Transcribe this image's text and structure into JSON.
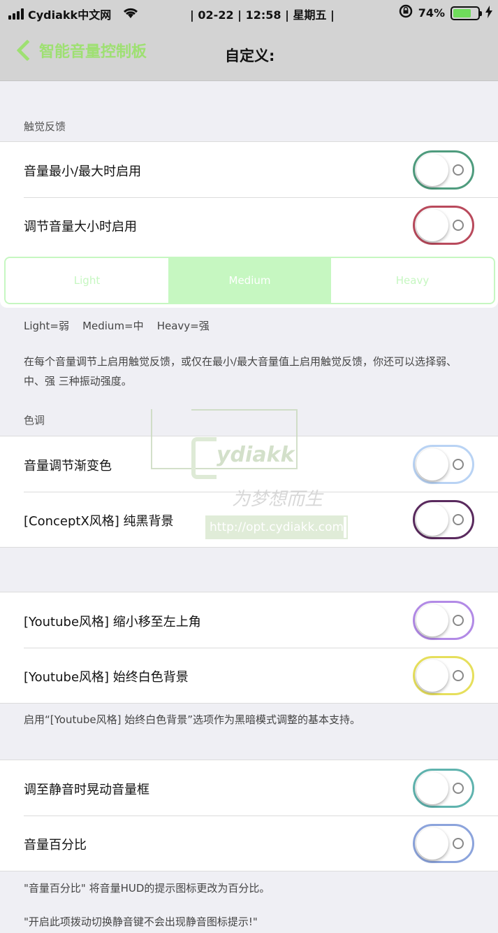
{
  "status_bar": {
    "carrier": "Cydiakk中文网",
    "center": "| 02-22 | 12:58 | 星期五 |",
    "battery_percent": "74%",
    "battery_level": 0.74
  },
  "nav": {
    "back_label": "智能音量控制板",
    "title": "自定义:"
  },
  "haptic_section": {
    "header": "触觉反馈",
    "rows": [
      {
        "label": "音量最小/最大时启用",
        "toggle_color": "#4f9c7e",
        "on": false
      },
      {
        "label": "调节音量大小时启用",
        "toggle_color": "#b94a5c",
        "on": false
      }
    ],
    "segments": [
      "Light",
      "Medium",
      "Heavy"
    ],
    "selected_segment": "Medium",
    "legend": "Light=弱    Medium=中    Heavy=强",
    "footer": "在每个音量调节上启用触觉反馈，或仅在最小/最大音量值上启用触觉反馈，你还可以选择弱、中、强 三种振动强度。"
  },
  "tone_section": {
    "header": "色调",
    "rows": [
      {
        "label": "音量调节渐变色",
        "toggle_color": "#b9d3f4",
        "on": false
      },
      {
        "label": "[ConceptX风格] 纯黑背景",
        "toggle_color": "#5a2a5e",
        "on": false
      }
    ]
  },
  "youtube_section": {
    "rows": [
      {
        "label": "[Youtube风格] 缩小移至左上角",
        "toggle_color": "#b28ae6",
        "on": false
      },
      {
        "label": "[Youtube风格] 始终白色背景",
        "toggle_color": "#e6df5c",
        "on": false
      }
    ],
    "footer": "启用“[Youtube风格] 始终白色背景”选项作为黑暗模式调整的基本支持。"
  },
  "misc_section": {
    "rows": [
      {
        "label": "调至静音时晃动音量框",
        "toggle_color": "#5fb3ae",
        "on": false
      },
      {
        "label": "音量百分比",
        "toggle_color": "#8ca4dc",
        "on": false
      }
    ],
    "footer_1": "\"音量百分比\" 将音量HUD的提示图标更改为百分比。",
    "footer_2": "\"开启此项拨动切换静音键不会出现静音图标提示!\""
  },
  "watermark": {
    "brand": "ydiakk",
    "signature": "为梦想而生",
    "url": "http://opt.cydiakk.com"
  }
}
